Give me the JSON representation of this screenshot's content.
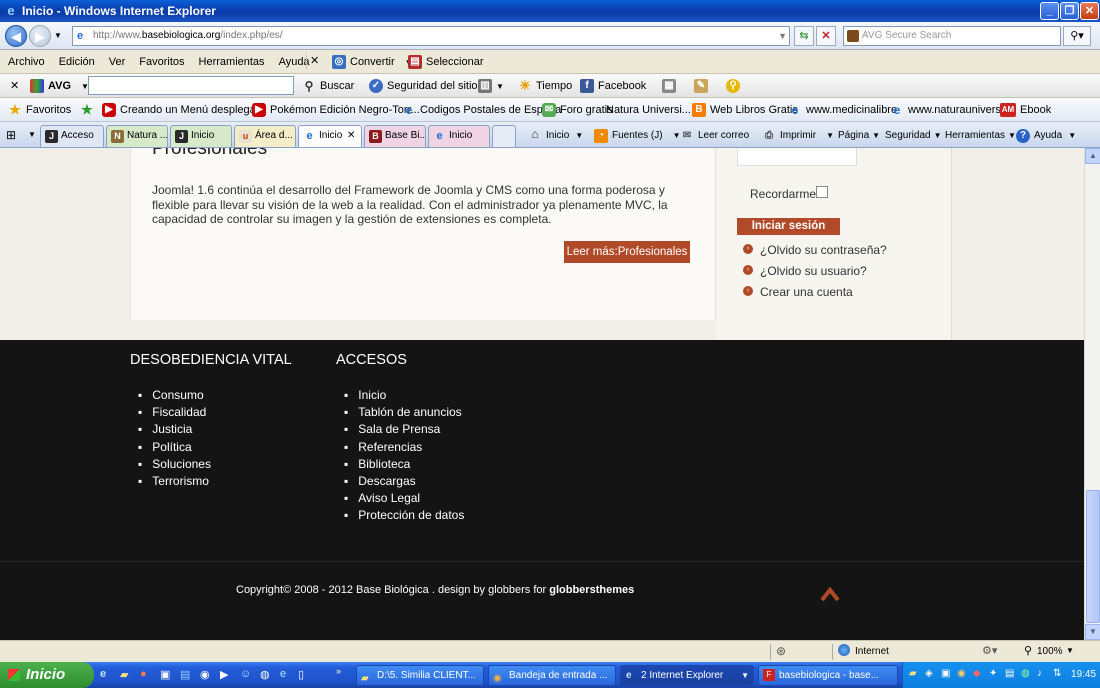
{
  "window": {
    "title": "Inicio - Windows Internet Explorer"
  },
  "address": {
    "prefix": "http://www.",
    "domain": "basebiologica.org",
    "path": "/index.php/es/",
    "search_placeholder": "AVG Secure Search"
  },
  "menubar": {
    "items": [
      "Archivo",
      "Edición",
      "Ver",
      "Favoritos",
      "Herramientas",
      "Ayuda"
    ],
    "convertir": "Convertir",
    "seleccionar": "Seleccionar"
  },
  "avg_toolbar": {
    "brand": "AVG",
    "buscar": "Buscar",
    "seguridad": "Seguridad del sitio",
    "tiempo": "Tiempo",
    "facebook": "Facebook"
  },
  "favorites": {
    "label": "Favoritos",
    "items": [
      "Creando un Menú desplega...",
      "Pokémon Edición Negro-Torr...",
      "Codigos Postales de España",
      "Foro gratis",
      "Natura Universi...",
      "Web Libros Gratis",
      "www.medicinalibre",
      "www.naturauniversia",
      "Ebook"
    ]
  },
  "tabs": [
    "Acceso",
    "Natura ...",
    "Inicio",
    "Área d...",
    "Inicio",
    "Base Bi...",
    "Inicio"
  ],
  "commandbar": [
    "Inicio",
    "Fuentes (J)",
    "Leer correo",
    "Imprimir",
    "Página",
    "Seguridad",
    "Herramientas",
    "Ayuda"
  ],
  "article": {
    "heading": "Profesionales",
    "body": "Joomla! 1.6 continúa el desarrollo del Framework de Joomla y CMS como una forma poderosa y flexible para llevar su visión de la web a la realidad. Con el administrador ya plenamente MVC, la capacidad de controlar su imagen y la gestión de extensiones es completa.",
    "read_more": "Leer más:Profesionales"
  },
  "login": {
    "remember": "Recordarme",
    "submit": "Iniciar sesión",
    "links": [
      "¿Olvido su contraseña?",
      "¿Olvido su usuario?",
      "Crear una cuenta"
    ]
  },
  "footer": {
    "col1": {
      "title": "DESOBEDIENCIA VITAL",
      "items": [
        "Consumo",
        "Fiscalidad",
        "Justicia",
        "Política",
        "Soluciones",
        "Terrorismo"
      ]
    },
    "col2": {
      "title": "ACCESOS",
      "items": [
        "Inicio",
        "Tablón de anuncios",
        "Sala de Prensa",
        "Referencias",
        "Biblioteca",
        "Descargas",
        "Aviso Legal",
        "Protección de datos"
      ]
    },
    "copyright": "Copyright© 2008 - 2012 Base Biológica . design by globbers for ",
    "brand": "globbersthemes"
  },
  "status": {
    "zone": "Internet",
    "zoom": "100%"
  },
  "taskbar": {
    "start": "Inicio",
    "tasks": [
      "D:\\5. Similia CLIENT...",
      "Bandeja de entrada ...",
      "2 Internet Explorer",
      "basebiologica - base..."
    ],
    "clock": "19:45"
  },
  "colors": {
    "accent": "#b04a28",
    "footer_bg": "#141414",
    "page_bg": "#f2efe9"
  }
}
